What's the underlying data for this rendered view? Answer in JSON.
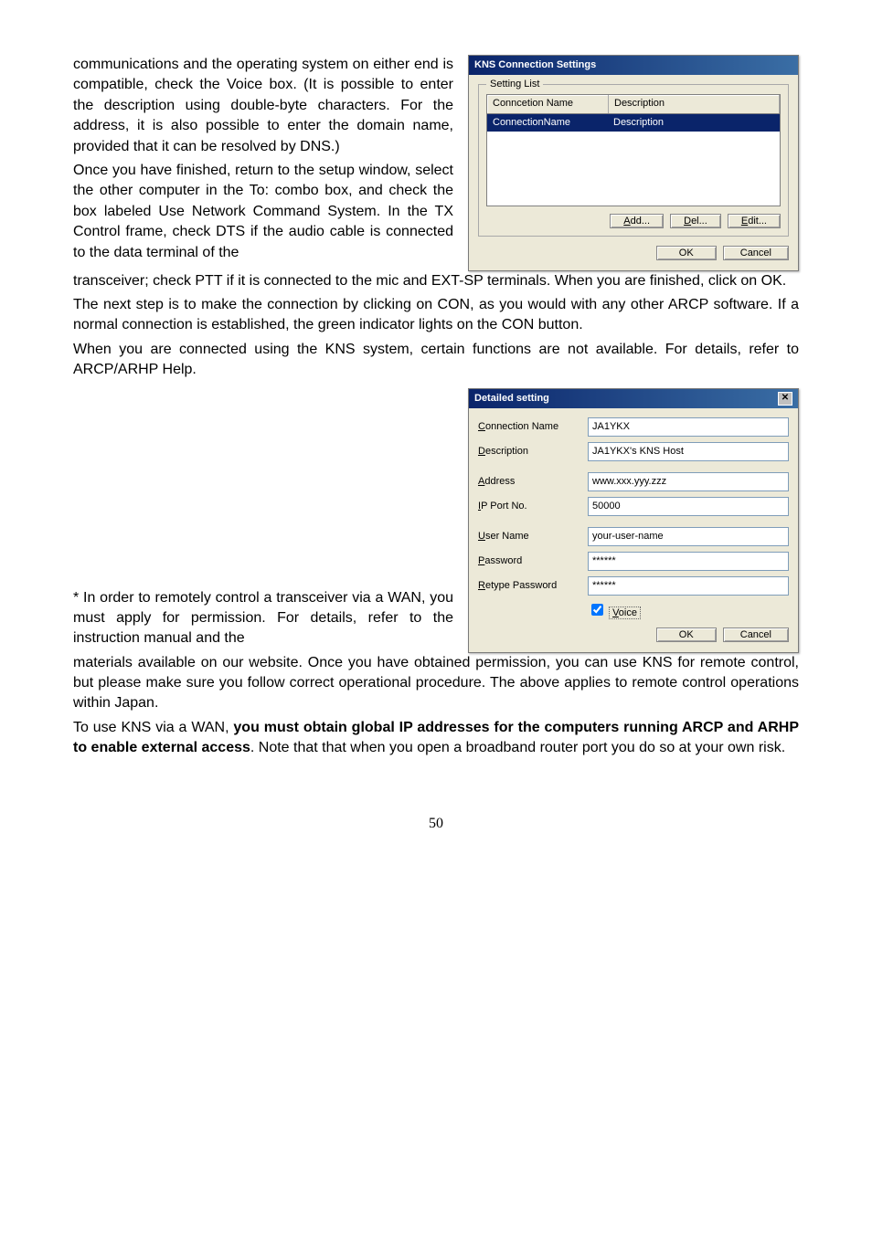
{
  "text": {
    "para1": "communications and the operating system on either end is compatible, check the Voice box. (It is possible to enter the description using double-byte characters. For the address, it is also possible to enter the domain name, provided that it can be resolved by DNS.)",
    "para2": "Once you have finished, return to the setup window, select the other computer in the To: combo box, and check the box labeled Use Network Command System. In the TX Control frame, check DTS if the audio cable is connected to the data terminal of the ",
    "para3": "transceiver; check PTT if it is connected to the mic and EXT-SP terminals. When you are finished, click on OK.",
    "para4": "The next step is to make the connection by clicking on CON, as you would with any other ARCP software. If a normal connection is established, the green indicator lights on the CON button.",
    "para5": "When you are connected using the KNS system, certain functions are not available. For details, refer to ARCP/ARHP Help.",
    "para6": "* In order to remotely control a transceiver via a WAN, you must apply for permission. For details, refer to the instruction manual and the",
    "para7": "materials available on our website. Once you have obtained permission, you can use KNS for remote control, but please make sure you follow correct operational procedure. The above applies to remote control operations within Japan.",
    "para8a": "To use KNS via a WAN, ",
    "para8b": "you must obtain global IP addresses for the computers running ARCP and ARHP to enable external access",
    "para8c": ". Note that that when you open a broadband router port you do so at your own risk."
  },
  "dlg1": {
    "title": "KNS Connection Settings",
    "group": "Setting List",
    "col_name": "Conncetion Name",
    "col_desc": "Description",
    "row_name": "ConnectionName",
    "row_desc": "Description",
    "add": "Add...",
    "del": "Del...",
    "edit": "Edit...",
    "ok": "OK",
    "cancel": "Cancel"
  },
  "dlg2": {
    "title": "Detailed setting",
    "connection_name_label": "Connection Name",
    "connection_name_value": "JA1YKX",
    "description_label": "Description",
    "description_value": "JA1YKX's KNS Host",
    "address_label": "Address",
    "address_value": "www.xxx.yyy.zzz",
    "ipport_label": "IP Port No.",
    "ipport_value": "50000",
    "username_label": "User Name",
    "username_value": "your-user-name",
    "password_label": "Password",
    "password_value": "******",
    "retype_label": "Retype Password",
    "retype_value": "******",
    "voice": "Voice",
    "ok": "OK",
    "cancel": "Cancel"
  },
  "page_num": "50"
}
